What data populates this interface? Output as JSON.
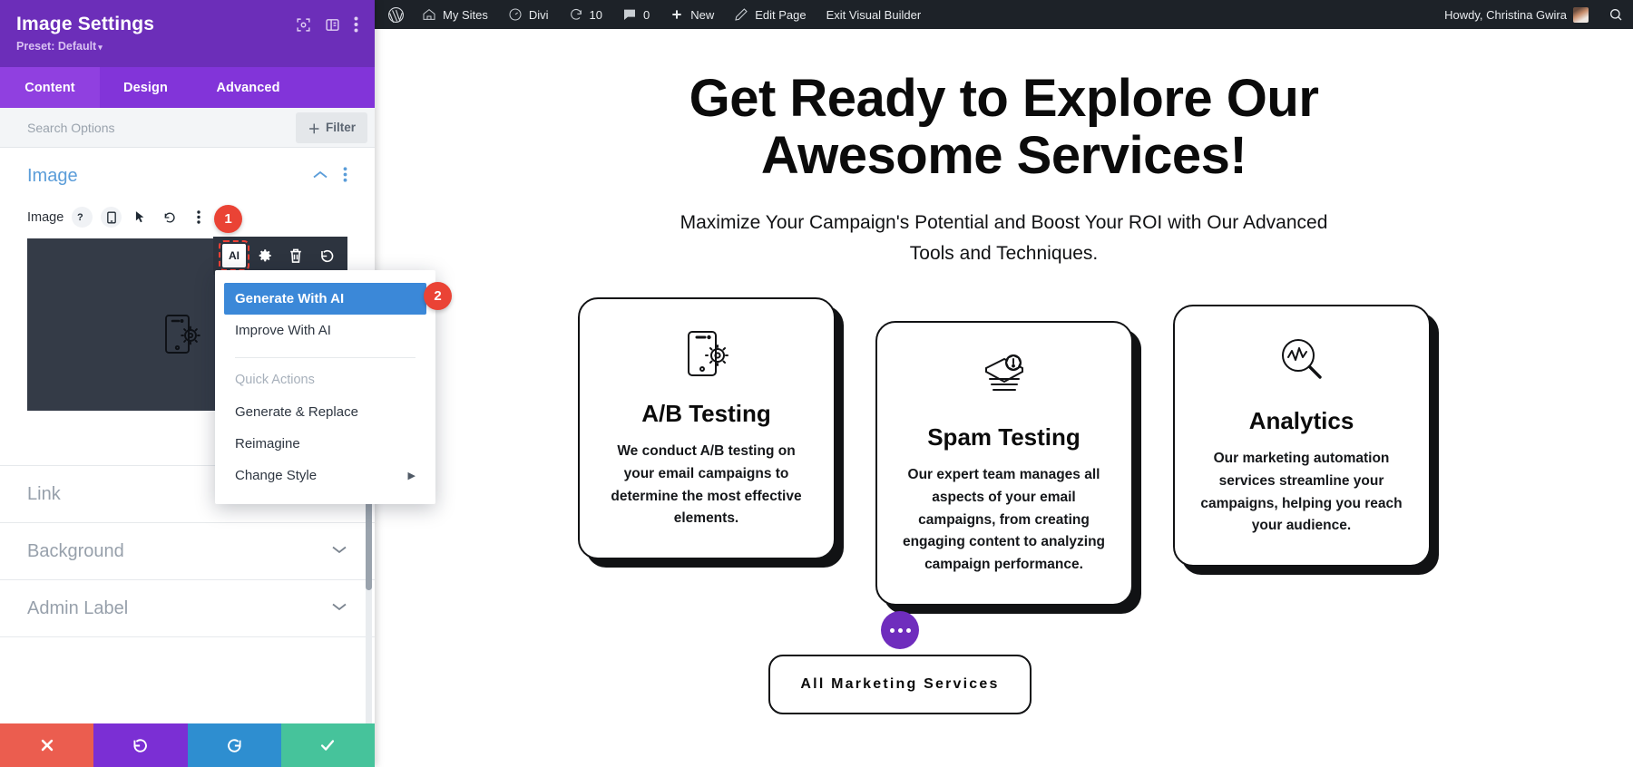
{
  "panel": {
    "title": "Image Settings",
    "preset_label": "Preset: Default",
    "header_icons": [
      "focus-target-icon",
      "layout-panel-icon",
      "kebab-menu-icon"
    ],
    "tabs": [
      {
        "label": "Content",
        "active": true
      },
      {
        "label": "Design",
        "active": false
      },
      {
        "label": "Advanced",
        "active": false
      }
    ],
    "search": {
      "placeholder": "Search Options",
      "value": ""
    },
    "filter_button": "Filter",
    "sections": [
      {
        "label": "Image",
        "state": "open"
      },
      {
        "label": "Link",
        "state": "collapsed"
      },
      {
        "label": "Background",
        "state": "collapsed"
      },
      {
        "label": "Admin Label",
        "state": "collapsed"
      }
    ],
    "image_field": {
      "label": "Image",
      "row_icons": [
        "help-icon",
        "responsive-phone-icon",
        "hover-cursor-icon",
        "reset-icon",
        "kebab-menu-icon"
      ],
      "toolbar": [
        {
          "name": "ai-icon",
          "label": "AI",
          "selected": true
        },
        {
          "name": "gear-icon",
          "label": "",
          "selected": false
        },
        {
          "name": "trash-icon",
          "label": "",
          "selected": false
        },
        {
          "name": "undo-icon",
          "label": "",
          "selected": false
        }
      ],
      "placeholder_icon": "phone-settings-icon"
    },
    "footer_buttons": [
      {
        "name": "cancel-button",
        "icon": "close-icon",
        "color": "#eb5d4f"
      },
      {
        "name": "undo-button",
        "icon": "undo-icon",
        "color": "#7b2fd4"
      },
      {
        "name": "redo-button",
        "icon": "redo-icon",
        "color": "#2e8ed0"
      },
      {
        "name": "save-button",
        "icon": "check-icon",
        "color": "#46c39b"
      }
    ]
  },
  "ai_menu": {
    "items": [
      {
        "label": "Generate With AI",
        "active": true,
        "submenu": false
      },
      {
        "label": "Improve With AI",
        "active": false,
        "submenu": false
      }
    ],
    "group_label": "Quick Actions",
    "quick_actions": [
      {
        "label": "Generate & Replace",
        "submenu": false
      },
      {
        "label": "Reimagine",
        "submenu": false
      },
      {
        "label": "Change Style",
        "submenu": true
      }
    ]
  },
  "badges": [
    {
      "number": "1"
    },
    {
      "number": "2"
    }
  ],
  "adminbar": {
    "items": [
      {
        "name": "wordpress-logo-icon",
        "label": ""
      },
      {
        "name": "my-sites",
        "label": "My Sites",
        "icon": "sites-icon"
      },
      {
        "name": "divi",
        "label": "Divi",
        "icon": "divi-speedometer-icon"
      },
      {
        "name": "updates",
        "label": "10",
        "icon": "updates-refresh-icon"
      },
      {
        "name": "comments",
        "label": "0",
        "icon": "comment-bubble-icon"
      },
      {
        "name": "new",
        "label": "New",
        "icon": "plus-icon"
      },
      {
        "name": "edit-page",
        "label": "Edit Page",
        "icon": "pencil-icon"
      },
      {
        "name": "exit-visual-builder",
        "label": "Exit Visual Builder",
        "icon": ""
      }
    ],
    "account": "Howdy, Christina Gwira",
    "search_icon": "search-icon"
  },
  "page": {
    "hero_title": "Get Ready to Explore Our Awesome Services!",
    "hero_subtitle": "Maximize Your Campaign's Potential and Boost Your ROI with Our Advanced Tools and Techniques.",
    "cards": [
      {
        "icon": "phone-settings-icon",
        "title": "A/B Testing",
        "text": "We conduct A/B testing on your email campaigns to determine the most effective elements."
      },
      {
        "icon": "spam-envelope-alert-icon",
        "title": "Spam Testing",
        "text": "Our expert team manages all aspects of your email campaigns, from creating engaging content to analyzing campaign performance."
      },
      {
        "icon": "analytics-magnifier-icon",
        "title": "Analytics",
        "text": "Our marketing automation services streamline your campaigns, helping you reach your audience."
      }
    ],
    "cta_label": "All Marketing Services",
    "dots_badge": "ellipsis-badge"
  },
  "colors": {
    "panel_header": "#6c2eb9",
    "tabs_bg": "#8234d9",
    "tab_active": "#9040e0",
    "section_open_title": "#5b9dd9",
    "menu_highlight": "#3b88d8",
    "badge": "#ea4335",
    "adminbar": "#1d2228",
    "image_placeholder": "#343b47",
    "accent_purple": "#6f2dbd"
  }
}
